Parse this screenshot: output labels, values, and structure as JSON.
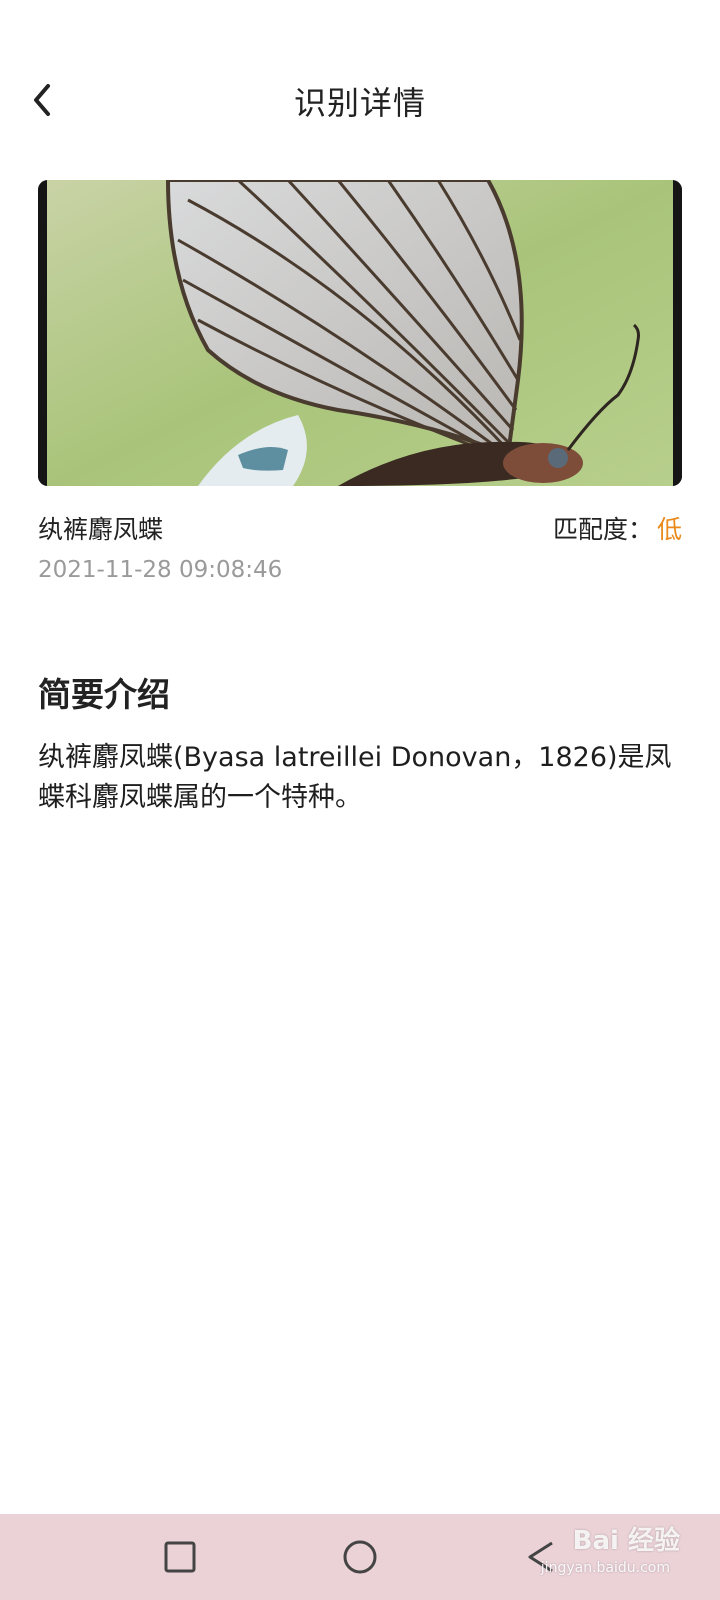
{
  "header": {
    "title": "识别详情",
    "back_icon": "chevron-left-icon"
  },
  "result": {
    "name": "纨裤麝凤蝶",
    "match_label": "匹配度：",
    "match_value": "低",
    "timestamp": "2021-11-28 09:08:46"
  },
  "intro": {
    "heading": "简要介绍",
    "text": "纨裤麝凤蝶(Byasa latreillei Donovan，1826)是凤蝶科麝凤蝶属的一个特种。"
  },
  "navbar": {
    "items": [
      "square-recents-icon",
      "circle-home-icon",
      "triangle-back-icon"
    ]
  },
  "watermark": {
    "text": "Bai 经验",
    "sub": "jingyan.baidu.com"
  },
  "colors": {
    "accent": "#e98a1b",
    "navbar_bg": "#ead2d7"
  }
}
